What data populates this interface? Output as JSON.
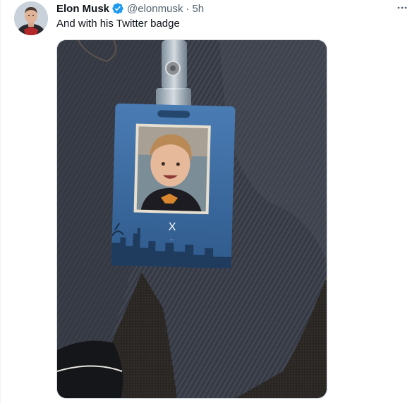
{
  "tweet": {
    "author_name": "Elon Musk",
    "author_handle": "@elonmusk",
    "separator": "·",
    "timestamp": "5h",
    "text": "And with his Twitter badge",
    "verified": true
  },
  "badge": {
    "letter": "X",
    "dots": "...",
    "card_color": "#3e6ea6"
  },
  "colors": {
    "verified_blue": "#1d9bf0",
    "secondary_text": "#536471"
  },
  "icons": {
    "verified": "verified-badge-icon",
    "more": "more-dots-icon"
  }
}
